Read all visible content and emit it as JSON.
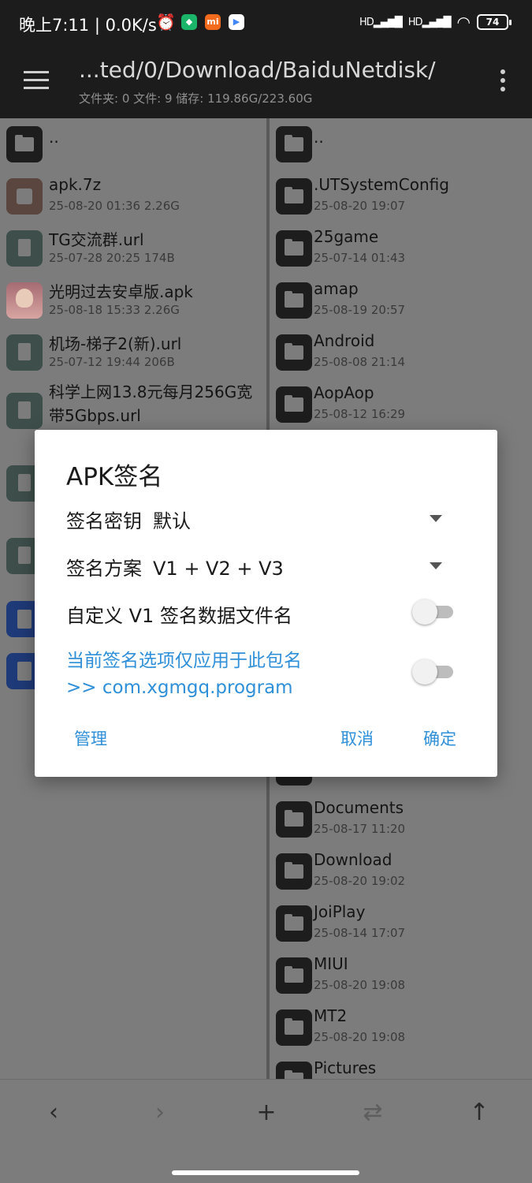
{
  "status_bar": {
    "time": "晚上7:11 | 0.0K/s",
    "alarm_icon": "⏰",
    "signal1": "HD",
    "signal2": "HD",
    "battery": "74"
  },
  "appbar": {
    "path": "...ted/0/Download/BaiduNetdisk/",
    "info": "文件夹: 0  文件: 9  储存: 119.86G/223.60G"
  },
  "left_pane": {
    "up": "..",
    "files": [
      {
        "name": "apk.7z",
        "meta": "25-08-20 01:36  2.26G",
        "icon": "archive-icon"
      },
      {
        "name": "TG交流群.url",
        "meta": "25-07-28 20:25  174B",
        "icon": "document-icon"
      },
      {
        "name": "光明过去安卓版.apk",
        "meta": "25-08-18 15:33  2.26G",
        "icon": "apk-icon"
      },
      {
        "name": "机场-梯子2(新).url",
        "meta": "25-07-12 19:44  206B",
        "icon": "document-icon"
      },
      {
        "name": "科学上网13.8元每月256G宽带5Gbps.url",
        "meta": "",
        "icon": "document-icon"
      }
    ]
  },
  "right_pane": {
    "up": "..",
    "folders": [
      {
        "name": ".UTSystemConfig",
        "meta": "25-08-20 19:07"
      },
      {
        "name": "25game",
        "meta": "25-07-14 01:43"
      },
      {
        "name": "amap",
        "meta": "25-08-19 20:57"
      },
      {
        "name": "Android",
        "meta": "25-08-08 21:14"
      },
      {
        "name": "AopAop",
        "meta": "25-08-12 16:29"
      },
      {
        "name": "Documents",
        "meta": "25-08-17 11:20"
      },
      {
        "name": "Download",
        "meta": "25-08-20 19:02"
      },
      {
        "name": "JoiPlay",
        "meta": "25-08-14 17:07"
      },
      {
        "name": "MIUI",
        "meta": "25-08-20 19:08"
      },
      {
        "name": "MT2",
        "meta": "25-08-20 19:08"
      },
      {
        "name": "Pictures",
        "meta": ""
      }
    ]
  },
  "dialog": {
    "title": "APK签名",
    "key_label": "签名密钥",
    "key_value": "默认",
    "scheme_label": "签名方案",
    "scheme_value": "V1 + V2 + V3",
    "custom_v1_label": "自定义 V1 签名数据文件名",
    "custom_v1_enabled": false,
    "package_note_line1": "当前签名选项仅应用于此包名",
    "package_note_line2": ">> com.xgmgq.program",
    "package_only_enabled": false,
    "manage_button": "管理",
    "cancel_button": "取消",
    "ok_button": "确定"
  },
  "toolbar": {
    "back": "‹",
    "forward": "›",
    "add": "+",
    "swap": "⇄",
    "up": "↑"
  }
}
